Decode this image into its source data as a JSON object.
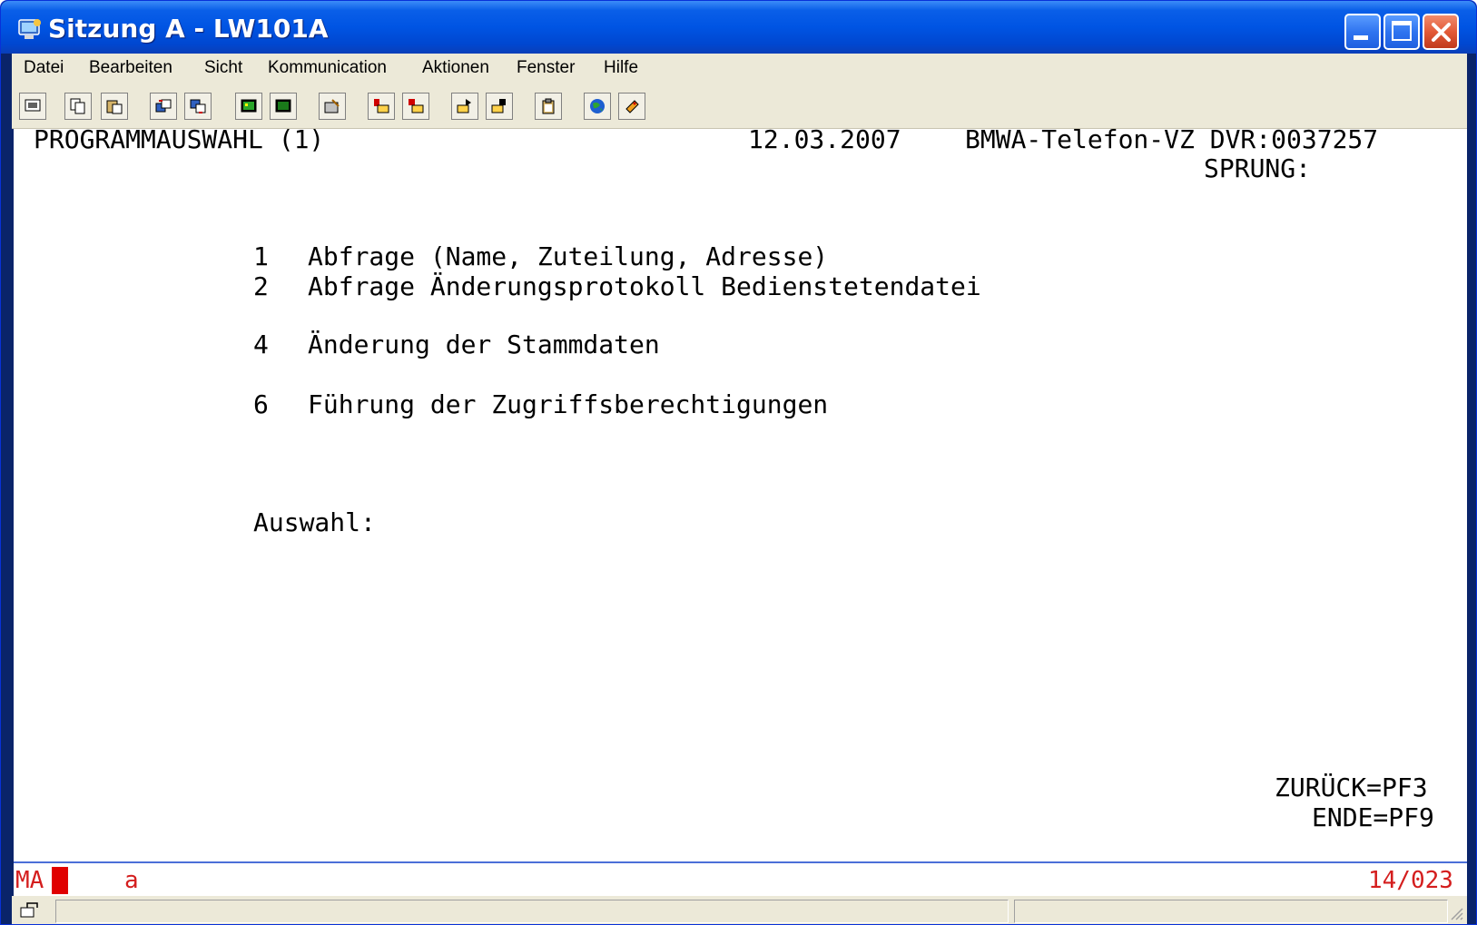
{
  "window": {
    "title": "Sitzung A - LW101A",
    "accent": "#0054e3",
    "close_color": "#e35a37"
  },
  "menu": {
    "items": [
      "Datei",
      "Bearbeiten",
      "Sicht",
      "Kommunication",
      "Aktionen",
      "Fenster",
      "Hilfe"
    ]
  },
  "toolbar": {
    "icons": [
      "display-icon",
      "copy-icon",
      "paste-icon",
      "send-icon",
      "receive-icon",
      "color-map-icon",
      "keyboard-map-icon",
      "macro-icon",
      "record-macro-icon",
      "stop-macro-icon",
      "play-macro-icon",
      "pause-macro-icon",
      "clipboard-icon",
      "web-icon",
      "help-icon"
    ]
  },
  "screen": {
    "header_title": "PROGRAMMAUSWAHL (1)",
    "header_date": "12.03.2007",
    "header_system": "BMWA-Telefon-VZ DVR:0037257",
    "sprung_label": "SPRUNG:",
    "options": [
      {
        "number": "1",
        "label": "Abfrage (Name, Zuteilung, Adresse)"
      },
      {
        "number": "2",
        "label": "Abfrage Änderungsprotokoll Bedienstetendatei"
      },
      {
        "number": "4",
        "label": "Änderung der Stammdaten"
      },
      {
        "number": "6",
        "label": "Führung der Zugriffsberechtigungen"
      }
    ],
    "auswahl_label": "Auswahl:",
    "back_key": "ZURÜCK=PF3",
    "end_key": "ENDE=PF9"
  },
  "status": {
    "mode": "MA",
    "session_indicator": "a",
    "cursor_position": "14/023",
    "text_color": "#d41e1e"
  }
}
